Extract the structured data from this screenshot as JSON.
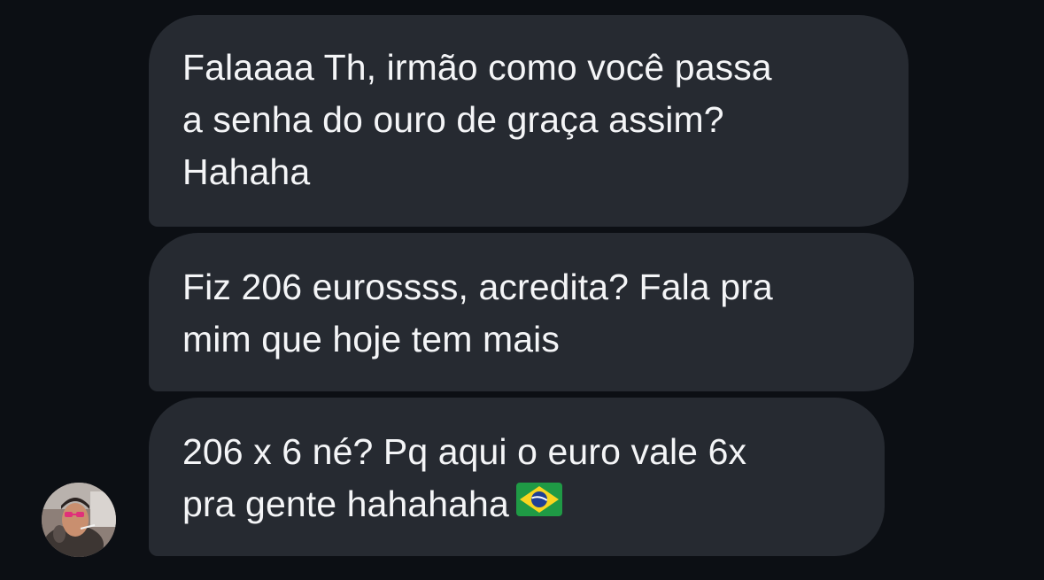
{
  "messages": [
    {
      "lines": [
        "Falaaaa Th, irmão como você passa",
        "a senha do ouro de graça assim?",
        "Hahaha"
      ]
    },
    {
      "lines": [
        "Fiz 206 eurossss, acredita? Fala pra",
        "mim que hoje tem mais"
      ]
    },
    {
      "lines": [
        "206 x 6 né? Pq aqui o euro vale 6x",
        "pra gente hahahaha"
      ],
      "emoji": "brazil-flag-icon"
    }
  ],
  "sender": {
    "avatar_icon": "sender-avatar"
  },
  "colors": {
    "background": "#0c0f14",
    "bubble": "#262a31",
    "text": "#f4f5f7"
  }
}
